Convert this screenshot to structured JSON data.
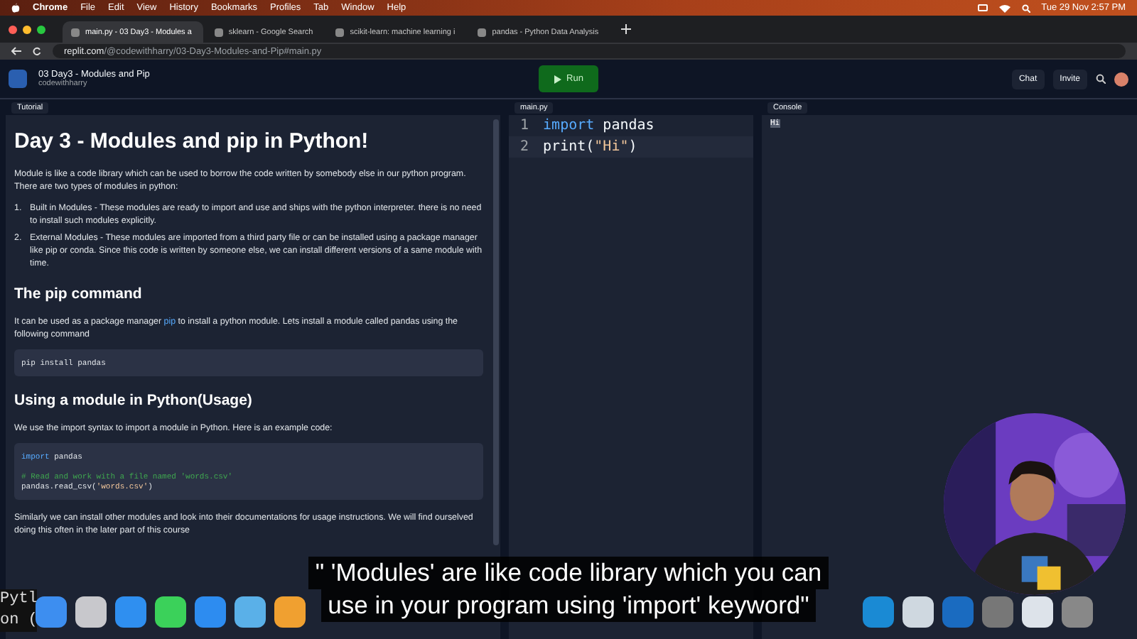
{
  "menubar": {
    "app": "Chrome",
    "items": [
      "File",
      "Edit",
      "View",
      "History",
      "Bookmarks",
      "Profiles",
      "Tab",
      "Window",
      "Help"
    ],
    "clock": "Tue 29 Nov  2:57 PM"
  },
  "browser_tabs": [
    {
      "title": "main.py - 03 Day3 - Modules a",
      "selected": true
    },
    {
      "title": "sklearn - Google Search",
      "selected": false
    },
    {
      "title": "scikit-learn: machine learning i",
      "selected": false
    },
    {
      "title": "pandas - Python Data Analysis",
      "selected": false
    }
  ],
  "address": {
    "host": "replit.com",
    "path": "/@codewithharry/03-Day3-Modules-and-Pip#main.py"
  },
  "repl": {
    "name": "03 Day3 - Modules and Pip",
    "owner": "codewithharry",
    "run": "Run",
    "chat": "Chat",
    "invite": "Invite"
  },
  "tutorial": {
    "tab": "Tutorial",
    "blocks": [
      {
        "kind": "h1",
        "text": "Day 3 - Modules and pip in Python!"
      },
      {
        "kind": "p",
        "text": "Module is like a code library which can be used to borrow the code written by somebody else in our python program. There are two types of modules in python:"
      },
      {
        "kind": "ol",
        "items": [
          {
            "number": "1.",
            "text": "Built in Modules - These modules are ready to import and use and ships with the python interpreter. there is no need to install such modules explicitly."
          },
          {
            "number": "2.",
            "text": "External Modules - These modules are imported from a third party file or can be installed using a package manager like pip or conda. Since this code is written by someone else, we can install different versions of a same module with time."
          }
        ]
      },
      {
        "kind": "h2",
        "text": "The pip command"
      },
      {
        "kind": "p",
        "before": "It can be used as a package manager ",
        "link": "pip",
        "after": " to install a python module. Lets install a module called pandas using the following command"
      },
      {
        "kind": "code",
        "lines": [
          {
            "tokens": [
              {
                "text": "pip install pandas",
                "kind": "plain"
              }
            ]
          }
        ]
      },
      {
        "kind": "h2",
        "text": "Using a module in Python(Usage)"
      },
      {
        "kind": "p",
        "text": "We use the import syntax to import a module in Python. Here is an example code:"
      },
      {
        "kind": "code",
        "lines": [
          {
            "tokens": [
              {
                "text": "import",
                "kind": "keyword"
              },
              {
                "text": " pandas",
                "kind": "plain"
              }
            ]
          },
          {
            "gap_before": true,
            "tokens": [
              {
                "text": "# Read and work with a file named 'words.csv'",
                "kind": "comment"
              }
            ]
          },
          {
            "tokens": [
              {
                "text": "pandas.read_csv(",
                "kind": "plain"
              },
              {
                "text": "'words.csv'",
                "kind": "string"
              },
              {
                "text": ")",
                "kind": "plain"
              }
            ]
          }
        ]
      },
      {
        "kind": "p",
        "text": "Similarly we can install other modules and look into their documentations for usage instructions. We will find ourselved doing this often in the later part of this course"
      }
    ]
  },
  "editor": {
    "tab": "main.py",
    "lines": [
      {
        "number": "1",
        "tokens": [
          {
            "text": "import",
            "kind": "keyword"
          },
          {
            "text": " pandas",
            "kind": "plain"
          }
        ]
      },
      {
        "number": "2",
        "tokens": [
          {
            "text": "print(",
            "kind": "plain"
          },
          {
            "text": "\"Hi\"",
            "kind": "string"
          },
          {
            "text": ")",
            "kind": "plain"
          }
        ]
      }
    ]
  },
  "console": {
    "tab": "Console",
    "output": "Hi"
  },
  "background_terminal": [
    "Pytl",
    "on ("
  ],
  "subtitle": [
    "\" 'Modules' are like code library which you can",
    "use in your program using 'import' keyword\""
  ]
}
